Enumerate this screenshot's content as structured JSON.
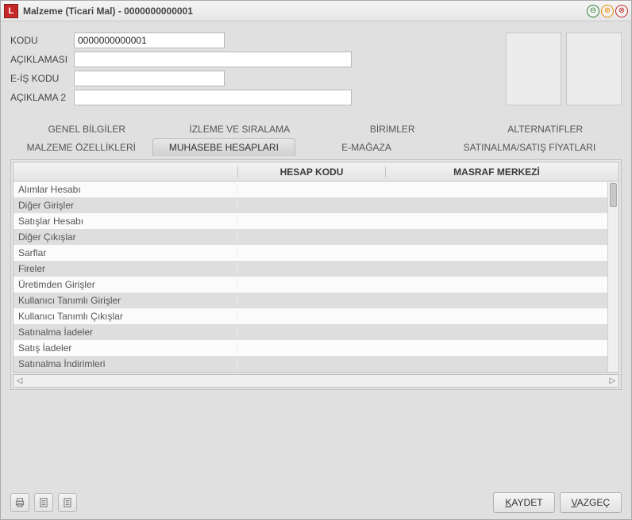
{
  "window": {
    "title": "Malzeme (Ticari Mal) - 0000000000001"
  },
  "form": {
    "kodu_label": "KODU",
    "kodu_value": "0000000000001",
    "aciklamasi_label": "AÇIKLAMASI",
    "aciklamasi_value": "",
    "eis_label": "E-İŞ KODU",
    "eis_value": "",
    "aciklama2_label": "AÇIKLAMA 2",
    "aciklama2_value": ""
  },
  "tabs": {
    "row1": [
      "GENEL BİLGİLER",
      "İZLEME VE SIRALAMA",
      "BİRİMLER",
      "ALTERNATİFLER"
    ],
    "row2": [
      "MALZEME ÖZELLİKLERİ",
      "MUHASEBE HESAPLARI",
      "E-MAĞAZA",
      "SATINALMA/SATIŞ FİYATLARI"
    ],
    "active": "MUHASEBE HESAPLARI"
  },
  "grid": {
    "headers": {
      "hesap": "HESAP KODU",
      "masraf": "MASRAF MERKEZİ"
    },
    "rows": [
      "Alımlar Hesabı",
      "Diğer Girişler",
      "Satışlar Hesabı",
      "Diğer Çıkışlar",
      "Sarflar",
      "Fireler",
      "Üretimden Girişler",
      "Kullanıcı Tanımlı Girişler",
      "Kullanıcı Tanımlı Çıkışlar",
      "Satınalma İadeler",
      "Satış İadeler",
      "Satınalma İndirimleri"
    ]
  },
  "footer": {
    "save": "KAYDET",
    "cancel": "VAZGEÇ"
  }
}
